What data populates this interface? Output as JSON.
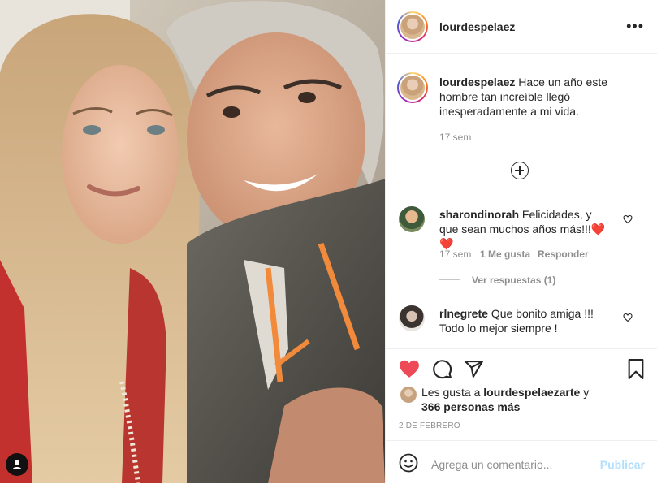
{
  "post": {
    "username": "lourdespelaez",
    "more_label": "•••"
  },
  "caption": {
    "username": "lourdespelaez",
    "text": "Hace un año este hombre tan increíble llegó inesperadamente a mi vida.",
    "time": "17 sem"
  },
  "comments": [
    {
      "username": "sharondinorah",
      "text": "Felicidades, y que sean muchos años más!!!❤️❤️",
      "time": "17 sem",
      "likes": "1 Me gusta",
      "reply_label": "Responder",
      "view_replies": "Ver respuestas (1)"
    },
    {
      "username": "rlnegrete",
      "text": "Que bonito amiga !!! Todo lo mejor siempre !"
    }
  ],
  "likes": {
    "prefix": "Les gusta a",
    "user": "lourdespelaezarte",
    "and": "y",
    "others": "366 personas más"
  },
  "date": "2 DE FEBRERO",
  "add_comment": {
    "placeholder": "Agrega un comentario...",
    "publish": "Publicar"
  },
  "colors": {
    "like_red": "#ed4956",
    "publish_blue": "#b2dffc",
    "muted": "#8e8e8e"
  }
}
